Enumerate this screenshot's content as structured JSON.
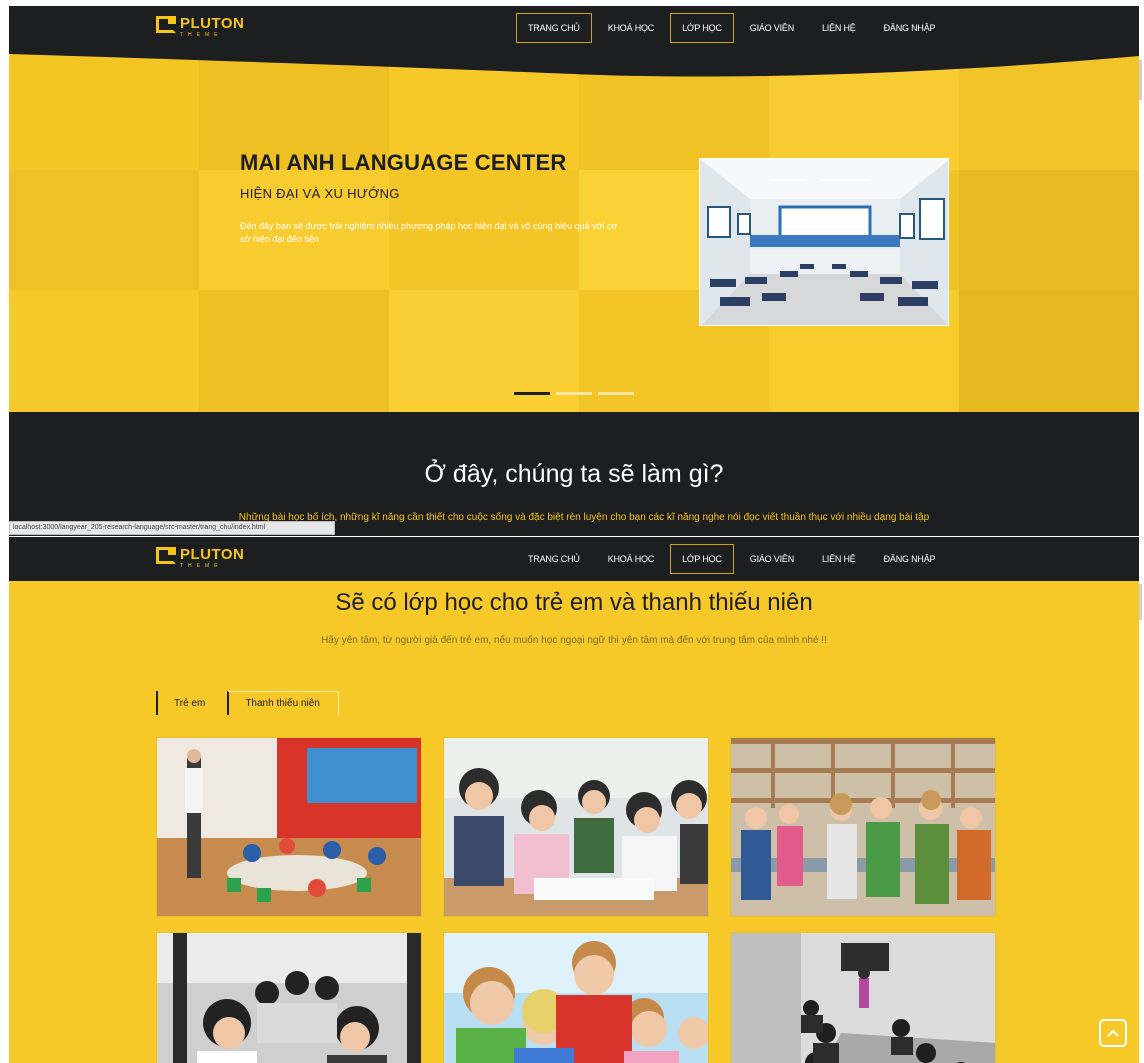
{
  "brand": {
    "name": "PLUTON",
    "sub": "THEME"
  },
  "nav": {
    "items": [
      "TRANG CHỦ",
      "KHOÁ HỌC",
      "LỚP HỌC",
      "GIÁO VIÊN",
      "LIÊN HỆ",
      "ĐĂNG NHẬP"
    ],
    "active_top": [
      "TRANG CHỦ",
      "LỚP HỌC"
    ],
    "active_bottom": "LỚP HỌC"
  },
  "hero": {
    "title": "MAI ANH LANGUAGE CENTER",
    "subtitle": "HIỆN ĐẠI VÀ XU HƯỚNG",
    "description": "Đến đây bạn sẽ được trải nghiệm nhiều phương pháp học hiện đại và vô cùng hiệu quả với cơ sở hiện đại đến tiên",
    "image_alt": "classroom",
    "slides": 3,
    "active_slide": 1
  },
  "intro": {
    "title": "Ở đây, chúng ta sẽ làm gì?",
    "text": "Những bài học bổ ích, những kĩ năng cần thiết cho cuộc sống và đặc biệt rèn luyện cho bạn các kĩ năng nghe nói đọc viết thuần thục với nhiều dạng bài tập"
  },
  "status_url": "localhost:3000/langyear_205-research-language/src-master/trang_chu/index.html",
  "classes": {
    "title": "Sẽ có lớp học cho trẻ em và thanh thiếu niên",
    "subtitle": "Hãy yên tâm, từ người già đến trẻ em, nếu muốn học ngoại ngữ thì yên tâm mà đến với trung tâm của mình nhé !!",
    "tabs": [
      "Trẻ em",
      "Thanh thiếu niên"
    ],
    "active_tab": 0,
    "photos": [
      "kids-classroom-photo",
      "teens-study-group-photo",
      "kids-table-photo",
      "students-workshop-photo",
      "happy-kids-photo",
      "dark-classroom-photo"
    ]
  },
  "colors": {
    "accent": "#f7c928",
    "dark": "#1d1e20"
  },
  "icons": {
    "scroll_top": "chevron-up-icon"
  }
}
